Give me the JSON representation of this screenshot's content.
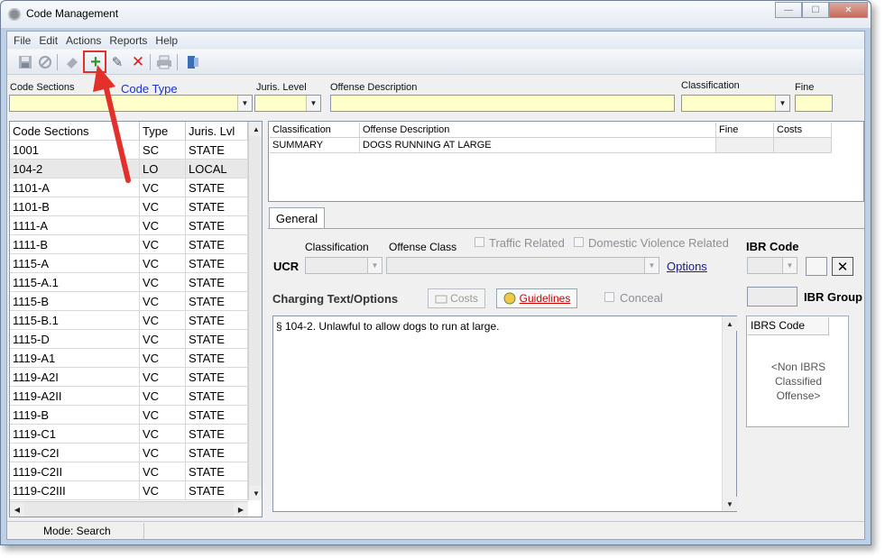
{
  "window": {
    "title": "Code Management",
    "min_glyph": "—",
    "max_glyph": "☐",
    "close_glyph": "✕"
  },
  "menu": [
    "File",
    "Edit",
    "Actions",
    "Reports",
    "Help"
  ],
  "toolbar": {
    "icons": [
      "save-icon",
      "cancel-icon",
      "eraser-icon",
      "add-icon",
      "edit-icon",
      "delete-icon",
      "print-icon",
      "exit-icon"
    ],
    "add_glyph": "+",
    "edit_glyph": "✎",
    "delete_glyph": "✕",
    "highlight_color": "#e2312a"
  },
  "search": {
    "code_sections_label": "Code Sections",
    "code_type_label": "Code Type",
    "juris_level_label": "Juris. Level",
    "offense_description_label": "Offense Description",
    "classification_label": "Classification",
    "fine_label": "Fine"
  },
  "codes_grid": {
    "headers": [
      "Code Sections",
      "Type",
      "Juris. Lvl"
    ],
    "rows": [
      [
        "1001",
        "SC",
        "STATE"
      ],
      [
        "104-2",
        "LO",
        "LOCAL"
      ],
      [
        "1101-A",
        "VC",
        "STATE"
      ],
      [
        "1101-B",
        "VC",
        "STATE"
      ],
      [
        "1111-A",
        "VC",
        "STATE"
      ],
      [
        "1111-B",
        "VC",
        "STATE"
      ],
      [
        "1115-A",
        "VC",
        "STATE"
      ],
      [
        "1115-A.1",
        "VC",
        "STATE"
      ],
      [
        "1115-B",
        "VC",
        "STATE"
      ],
      [
        "1115-B.1",
        "VC",
        "STATE"
      ],
      [
        "1115-D",
        "VC",
        "STATE"
      ],
      [
        "1119-A1",
        "VC",
        "STATE"
      ],
      [
        "1119-A2I",
        "VC",
        "STATE"
      ],
      [
        "1119-A2II",
        "VC",
        "STATE"
      ],
      [
        "1119-B",
        "VC",
        "STATE"
      ],
      [
        "1119-C1",
        "VC",
        "STATE"
      ],
      [
        "1119-C2I",
        "VC",
        "STATE"
      ],
      [
        "1119-C2II",
        "VC",
        "STATE"
      ],
      [
        "1119-C2III",
        "VC",
        "STATE"
      ]
    ],
    "selected_row": 1
  },
  "offense_grid": {
    "headers": [
      "Classification",
      "Offense Description",
      "Fine",
      "Costs"
    ],
    "rows": [
      [
        "SUMMARY",
        "DOGS RUNNING AT LARGE",
        "",
        ""
      ]
    ]
  },
  "tabs": {
    "general": "General"
  },
  "general": {
    "classification_label": "Classification",
    "offense_class_label": "Offense Class",
    "traffic_related": "Traffic Related",
    "domestic_violence": "Domestic Violence Related",
    "ibr_code_label": "IBR Code",
    "ucr_label": "UCR",
    "options_link": "Options",
    "charging_text_label": "Charging Text/Options",
    "costs_button": "Costs",
    "guidelines_button": "Guidelines",
    "conceal_label": "Conceal",
    "ibr_group_label": "IBR Group",
    "charging_text": "§ 104-2. Unlawful to allow dogs to run at large.",
    "ibrs_code_header": "IBRS Code",
    "ibrs_note": "<Non IBRS Classified Offense>",
    "clear_glyph": "✕"
  },
  "status": {
    "mode": "Mode: Search"
  },
  "colors": {
    "required_field": "#ffffcc",
    "link": "#0000cc",
    "guidelines_link": "#cc0000",
    "arrow": "#e2312a"
  }
}
